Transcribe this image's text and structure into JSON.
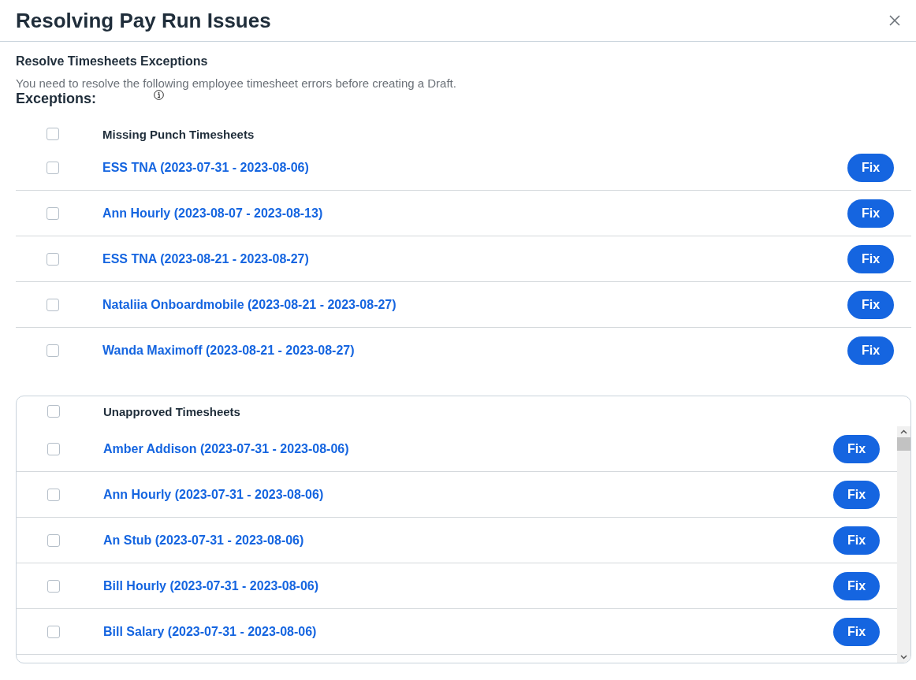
{
  "dialog": {
    "title": "Resolving Pay Run Issues"
  },
  "section": {
    "heading": "Resolve Timesheets Exceptions",
    "description": "You need to resolve the following employee timesheet errors before creating a Draft.",
    "exceptions_label": "Exceptions:"
  },
  "groups": [
    {
      "kind": "plain",
      "title": "Missing Punch Timesheets",
      "checked": false,
      "rows": [
        {
          "label": "ESS TNA (2023-07-31 - 2023-08-06)",
          "checked": false,
          "action": "Fix"
        },
        {
          "label": "Ann Hourly (2023-08-07 - 2023-08-13)",
          "checked": false,
          "action": "Fix"
        },
        {
          "label": "ESS TNA (2023-08-21 - 2023-08-27)",
          "checked": false,
          "action": "Fix"
        },
        {
          "label": "Nataliia Onboardmobile (2023-08-21 - 2023-08-27)",
          "checked": false,
          "action": "Fix"
        },
        {
          "label": "Wanda Maximoff (2023-08-21 - 2023-08-27)",
          "checked": false,
          "action": "Fix"
        }
      ]
    },
    {
      "kind": "scrolling",
      "title": "Unapproved Timesheets",
      "checked": false,
      "rows": [
        {
          "label": "Amber Addison (2023-07-31 - 2023-08-06)",
          "checked": false,
          "action": "Fix"
        },
        {
          "label": "Ann Hourly (2023-07-31 - 2023-08-06)",
          "checked": false,
          "action": "Fix"
        },
        {
          "label": "An Stub (2023-07-31 - 2023-08-06)",
          "checked": false,
          "action": "Fix"
        },
        {
          "label": "Bill Hourly (2023-07-31 - 2023-08-06)",
          "checked": false,
          "action": "Fix"
        },
        {
          "label": "Bill Salary (2023-07-31 - 2023-08-06)",
          "checked": false,
          "action": "Fix"
        }
      ]
    }
  ]
}
